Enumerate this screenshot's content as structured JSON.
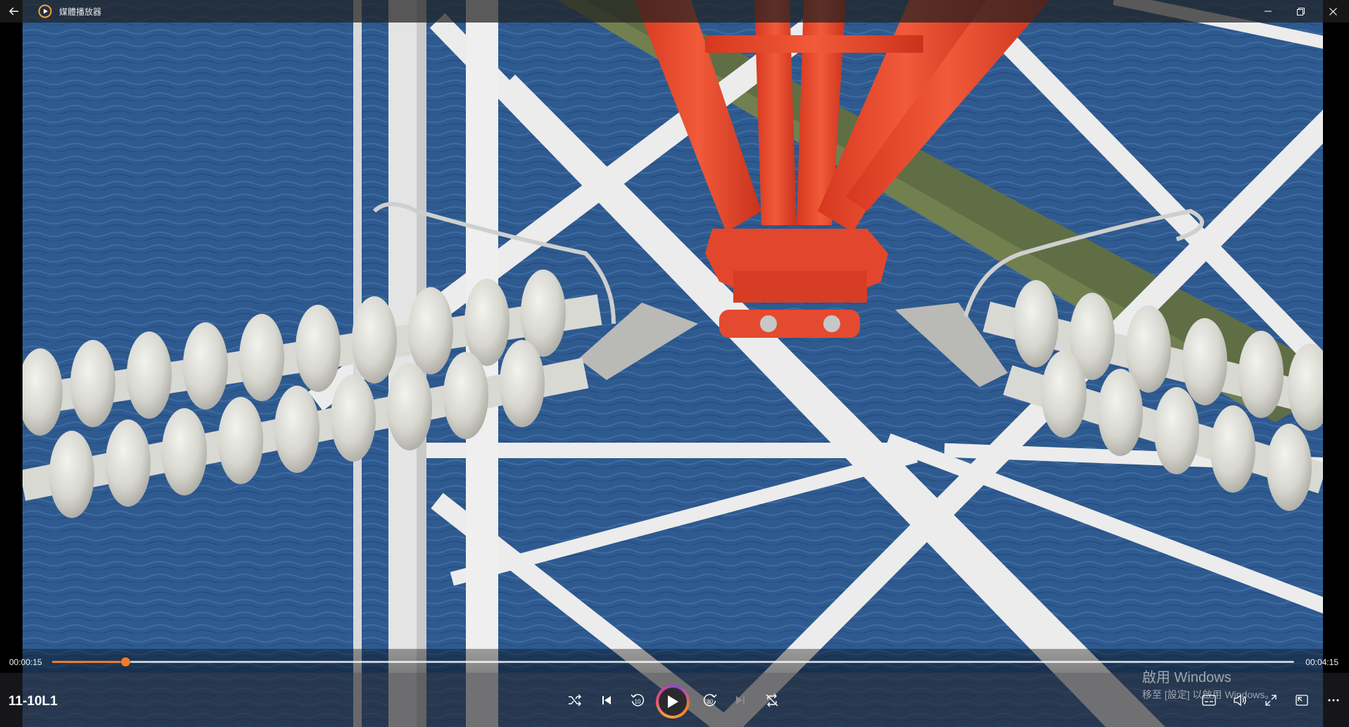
{
  "window": {
    "app_title": "媒體播放器",
    "icons": {
      "back": "back-arrow-icon",
      "app": "media-player-app-icon",
      "minimize": "minimize-icon",
      "restore": "restore-icon",
      "close": "close-icon"
    }
  },
  "video": {
    "scene": "transmission-tower-insulator-strings-over-water",
    "colors": {
      "water": "#2f5a8f",
      "tower_white": "#e9eaea",
      "tower_red": "#e8452a",
      "grass": "#6d7a4a"
    }
  },
  "playback": {
    "current_time": "00:00:15",
    "total_time": "00:04:15",
    "progress_fraction": 0.059,
    "accent_color": "#f07c2a"
  },
  "media": {
    "title": "11-10L1"
  },
  "controls": {
    "center": [
      {
        "id": "shuffle",
        "icon": "shuffle-icon"
      },
      {
        "id": "previous",
        "icon": "previous-track-icon"
      },
      {
        "id": "rewind",
        "icon": "rewind-10-icon",
        "label": "10"
      },
      {
        "id": "play",
        "icon": "play-icon"
      },
      {
        "id": "forward",
        "icon": "forward-30-icon",
        "label": "30"
      },
      {
        "id": "next",
        "icon": "next-track-icon"
      },
      {
        "id": "repeat",
        "icon": "repeat-off-icon"
      }
    ],
    "right": [
      {
        "id": "captions",
        "icon": "captions-icon"
      },
      {
        "id": "volume",
        "icon": "volume-icon"
      },
      {
        "id": "fullscreen",
        "icon": "fullscreen-icon"
      },
      {
        "id": "miniplayer",
        "icon": "miniplayer-icon"
      },
      {
        "id": "more",
        "icon": "more-options-icon"
      }
    ]
  },
  "watermark": {
    "line1": "啟用 Windows",
    "line2": "移至 [設定] 以啟用 Windows。"
  }
}
